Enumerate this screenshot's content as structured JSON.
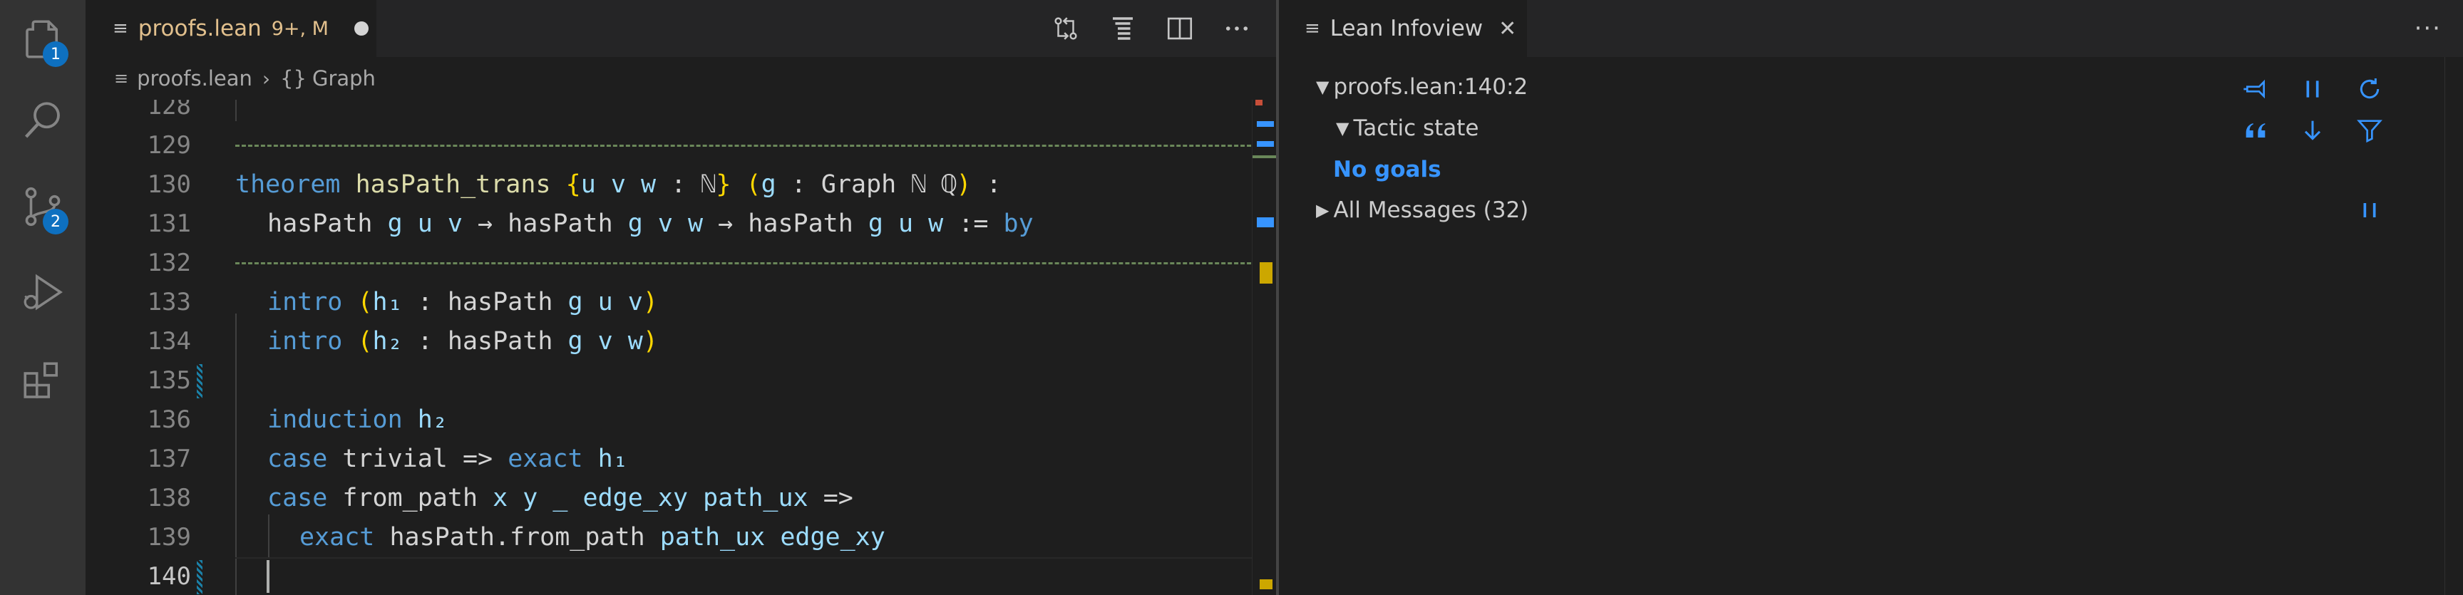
{
  "activity_bar": {
    "explorer_badge": "1",
    "scm_badge": "2",
    "items": [
      {
        "icon": "files-icon"
      },
      {
        "icon": "search-icon"
      },
      {
        "icon": "source-control-icon"
      },
      {
        "icon": "run-debug-icon"
      },
      {
        "icon": "extensions-icon"
      }
    ]
  },
  "editor": {
    "tab": {
      "filename": "proofs.lean",
      "status": "9+, M"
    },
    "breadcrumb": {
      "file": "proofs.lean",
      "symbol_braces": "{}",
      "symbol": "Graph"
    },
    "lines": [
      {
        "num": "128"
      },
      {
        "num": "129"
      },
      {
        "num": "130"
      },
      {
        "num": "131"
      },
      {
        "num": "132"
      },
      {
        "num": "133"
      },
      {
        "num": "134"
      },
      {
        "num": "135"
      },
      {
        "num": "136"
      },
      {
        "num": "137"
      },
      {
        "num": "138"
      },
      {
        "num": "139"
      },
      {
        "num": "140"
      }
    ],
    "code": {
      "l130_theorem": "theorem",
      "l130_name": "hasPath_trans",
      "l130_open": "{",
      "l130_vars": "u v w",
      "l130_colon": " : ℕ",
      "l130_close": "}",
      "l130_p_open": "(",
      "l130_g": "g",
      "l130_graph": " : Graph ℕ ℚ",
      "l130_p_close": ")",
      "l130_end": " :",
      "l131_a": "hasPath ",
      "l131_b": "g u v",
      "l131_c": " → hasPath ",
      "l131_d": "g v w",
      "l131_e": " → hasPath ",
      "l131_f": "g u w",
      "l131_g": " := ",
      "l131_by": "by",
      "l133_intro": "intro",
      "l133_open": "(",
      "l133_h": "h₁",
      "l133_rest": " : hasPath ",
      "l133_args": "g u v",
      "l133_close": ")",
      "l134_intro": "intro",
      "l134_open": "(",
      "l134_h": "h₂",
      "l134_rest": " : hasPath ",
      "l134_args": "g v w",
      "l134_close": ")",
      "l136_kw": "induction",
      "l136_h": "h₂",
      "l137_case": "case",
      "l137_name": "trivial",
      "l137_arrow": " => ",
      "l137_exact": "exact",
      "l137_h": "h₁",
      "l138_case": "case",
      "l138_name": "from_path",
      "l138_args": "x y _ edge_xy path_ux",
      "l138_arrow": " =>",
      "l139_exact": "exact",
      "l139_fn": "hasPath.from_path",
      "l139_args": "path_ux edge_xy"
    }
  },
  "infoview": {
    "tab_title": "Lean Infoview",
    "location": "proofs.lean:140:2",
    "tactic_state_label": "Tactic state",
    "goals_text": "No goals",
    "messages_label": "All Messages (32)"
  },
  "colors": {
    "accent": "#0e70c0",
    "keyword": "#569cd6",
    "variable": "#9cdcfe",
    "bracket": "#ffd700",
    "modified_tab": "#e2c08d",
    "info_link": "#3794ff"
  }
}
